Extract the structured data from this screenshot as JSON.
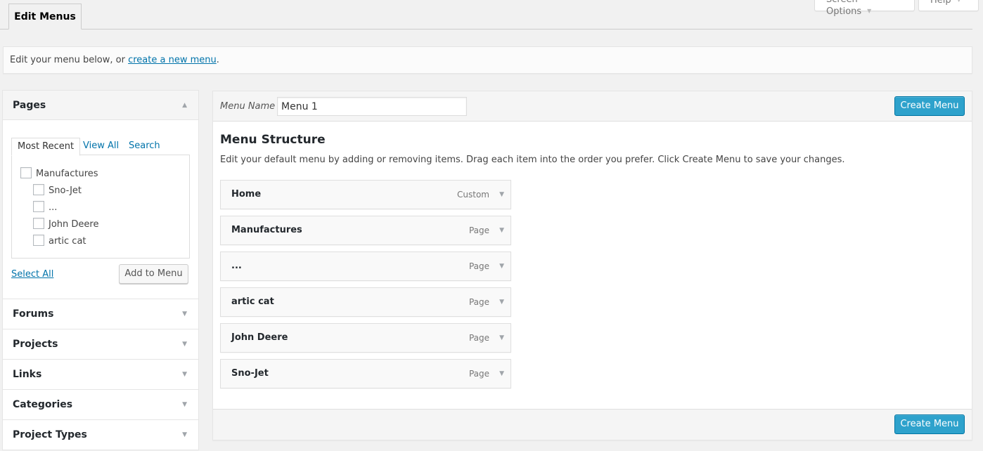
{
  "screen_meta": {
    "screen_options": "Screen Options",
    "help": "Help"
  },
  "nav": {
    "tab": "Edit Menus"
  },
  "notice": {
    "prefix": "Edit your menu below, or ",
    "link": "create a new menu",
    "suffix": "."
  },
  "sidebar": {
    "pages": {
      "title": "Pages",
      "tabs": [
        "Most Recent",
        "View All",
        "Search"
      ],
      "items": [
        {
          "label": "Manufactures",
          "level": 0
        },
        {
          "label": "Sno-Jet",
          "level": 1
        },
        {
          "label": "...",
          "level": 1
        },
        {
          "label": "John Deere",
          "level": 1
        },
        {
          "label": "artic cat",
          "level": 1
        }
      ],
      "select_all": "Select All",
      "add_button": "Add to Menu"
    },
    "sections": [
      "Forums",
      "Projects",
      "Links",
      "Categories",
      "Project Types"
    ]
  },
  "menu": {
    "name_label": "Menu Name",
    "name_value": "Menu 1",
    "create_button": "Create Menu",
    "structure_title": "Menu Structure",
    "structure_desc": "Edit your default menu by adding or removing items. Drag each item into the order you prefer. Click Create Menu to save your changes.",
    "items": [
      {
        "title": "Home",
        "type": "Custom"
      },
      {
        "title": "Manufactures",
        "type": "Page"
      },
      {
        "title": "...",
        "type": "Page"
      },
      {
        "title": "artic cat",
        "type": "Page"
      },
      {
        "title": "John Deere",
        "type": "Page"
      },
      {
        "title": "Sno-Jet",
        "type": "Page"
      }
    ],
    "footer_button": "Create Menu"
  },
  "icons": {
    "collapse": "triangle-up-icon",
    "expand": "triangle-down-icon",
    "checkbox": "checkbox-icon"
  }
}
